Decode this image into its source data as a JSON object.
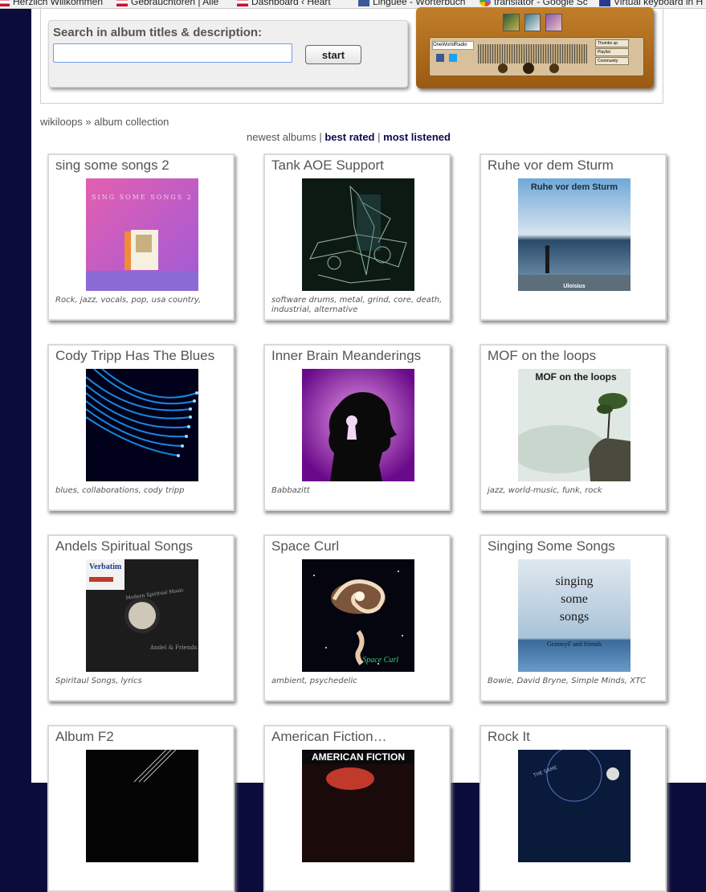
{
  "bookmarks": [
    {
      "label": "Herzlich Willkommen",
      "icon": "flag-icon"
    },
    {
      "label": "Gebrauchtoren | Alle",
      "icon": "flag-icon"
    },
    {
      "label": "Dashboard ‹ Heart",
      "icon": "flag-icon"
    },
    {
      "label": "Linguee - Wörterbuch",
      "icon": "linguee-icon"
    },
    {
      "label": "translator - Google Sc",
      "icon": "google-translate-icon"
    },
    {
      "label": "Virtual keyboard in H",
      "icon": "keyboard-icon"
    }
  ],
  "search": {
    "label": "Search in album titles & description:",
    "value": "",
    "button": "start"
  },
  "radio": {
    "station": "OneWorldRadio",
    "buttons": [
      "Thumbs up",
      "Playlist",
      "Community"
    ]
  },
  "breadcrumb": "wikiloops » album collection",
  "tabs": {
    "newest": "newest albums",
    "sep1": "|",
    "best": "best rated",
    "sep2": "|",
    "most": "most listened"
  },
  "albums": [
    {
      "title": "sing some songs 2",
      "tags": "Rock, jazz, vocals, pop, usa country,",
      "cover": "pink-collage"
    },
    {
      "title": "Tank AOE Support",
      "tags": "software drums, metal, grind, core, death, industrial, alternative",
      "cover": "green-sketch"
    },
    {
      "title": "Ruhe vor dem Sturm",
      "tags": "",
      "cover": "sea-storm",
      "cover_text": "Ruhe vor dem Sturm",
      "cover_sub": "Uloisius"
    },
    {
      "title": "Cody Tripp Has The Blues",
      "tags": "blues, collaborations, cody tripp",
      "cover": "fiber-optics"
    },
    {
      "title": "Inner Brain Meanderings",
      "tags": "Babbazitt",
      "cover": "keyhole-head"
    },
    {
      "title": "MOF on the loops",
      "tags": "jazz, world-music, funk, rock",
      "cover": "cliff-tree",
      "cover_text": "MOF on the loops"
    },
    {
      "title": "Andels Spiritual Songs",
      "tags": "Spiritaul Songs, lyrics",
      "cover": "floppy-disk",
      "cover_text": "Verbatim",
      "cover_sub": "Andel & Friends"
    },
    {
      "title": "Space Curl",
      "tags": "ambient, psychedelic",
      "cover": "galaxy",
      "cover_text": "Space Curl"
    },
    {
      "title": "Singing Some Songs",
      "tags": "Bowie, David Bryne, Simple Minds, XTC",
      "cover": "sky-sea",
      "cover_text": "singing some songs",
      "cover_sub": "GemmyF and friends"
    },
    {
      "title": "Album F2",
      "tags": "",
      "cover": "guitar-dark"
    },
    {
      "title": "American Fiction…",
      "tags": "",
      "cover": "american-fiction",
      "cover_text": "AMERICAN FICTION"
    },
    {
      "title": "Rock It",
      "tags": "",
      "cover": "dark-blue-rock"
    }
  ],
  "colors": {
    "page_bg": "#0b0b3c",
    "link": "#0b0b4c",
    "card_border": "#d9d9d9",
    "text": "#555555"
  }
}
